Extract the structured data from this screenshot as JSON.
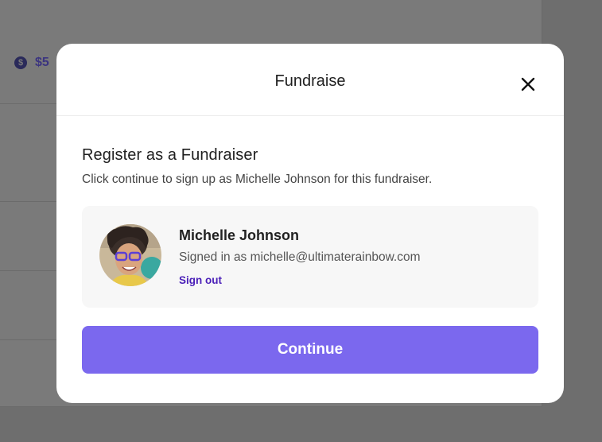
{
  "background": {
    "amount_text": "$5",
    "dollar_icon_glyph": "$"
  },
  "modal": {
    "title": "Fundraise",
    "close_icon": "close-icon",
    "heading": "Register as a Fundraiser",
    "description": "Click continue to sign up as Michelle Johnson for this fundraiser.",
    "user": {
      "name": "Michelle Johnson",
      "signed_in_text": "Signed in as michelle@ultimaterainbow.com",
      "sign_out_label": "Sign out"
    },
    "continue_label": "Continue"
  },
  "colors": {
    "overlay": "#7a7a7a",
    "primary_button": "#7b68ee",
    "link": "#4a1fb8",
    "card_bg": "#f7f7f7"
  }
}
